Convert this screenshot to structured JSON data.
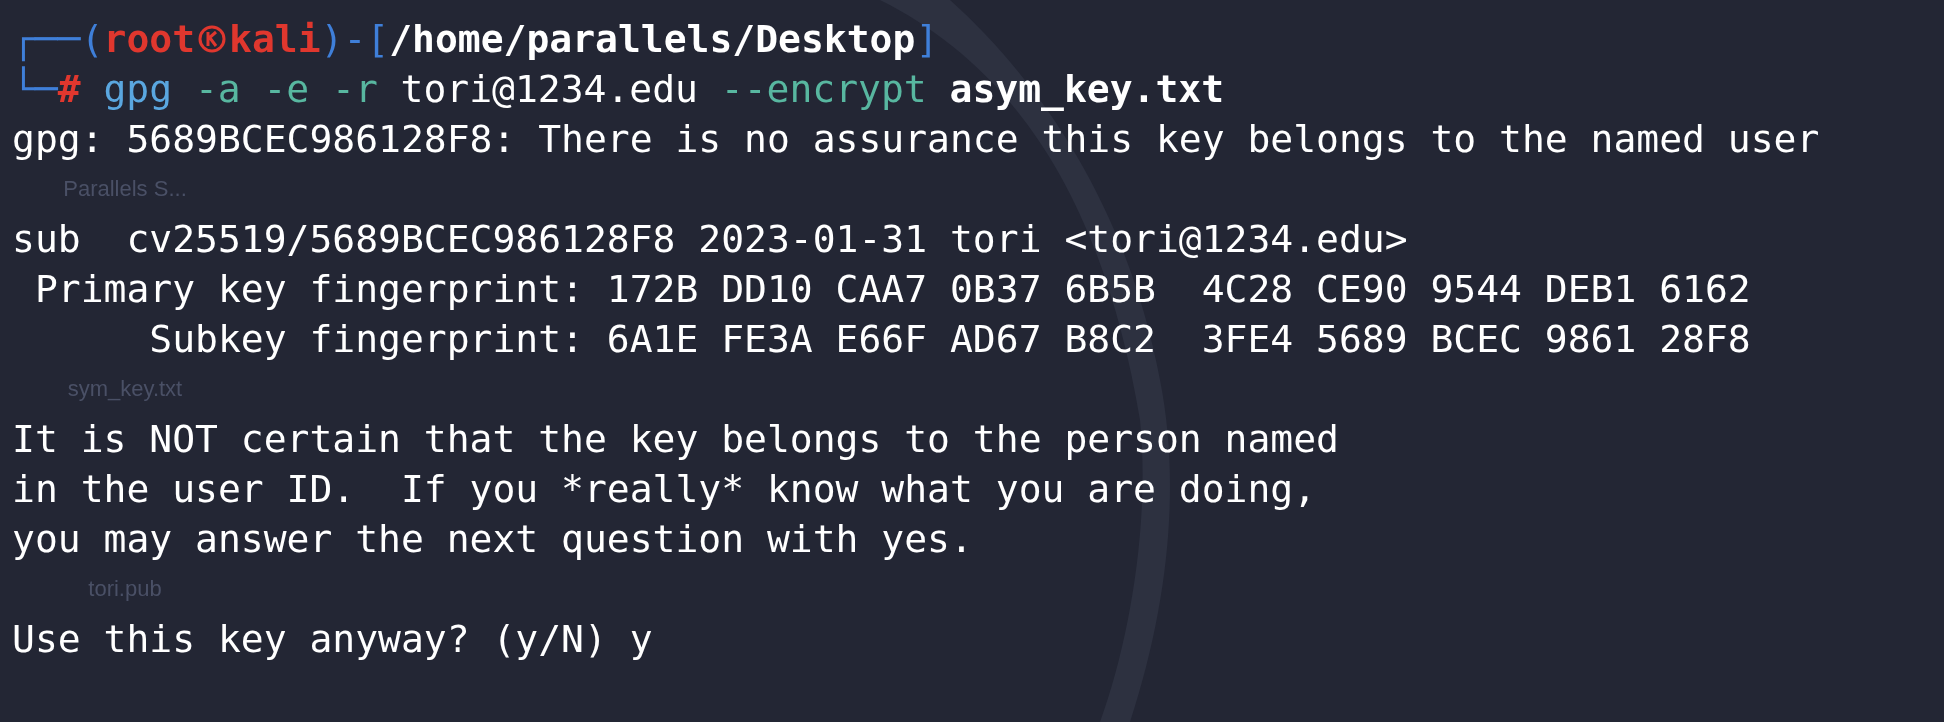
{
  "desktop_icons": [
    {
      "label": "Parallels S..."
    },
    {
      "label": "sym_key.txt"
    },
    {
      "label": "tori.pub"
    }
  ],
  "prompt": {
    "corner_top": "┌──(",
    "separator": ")-[",
    "close": "]",
    "corner_bottom": "└─",
    "user": "root",
    "host": "kali",
    "path": "/home/parallels/Desktop",
    "symbol": "#",
    "command": [
      {
        "kind": "program",
        "text": "gpg"
      },
      {
        "kind": "option",
        "text": "-a"
      },
      {
        "kind": "option",
        "text": "-e"
      },
      {
        "kind": "option",
        "text": "-r"
      },
      {
        "kind": "argument",
        "text": "tori@1234.edu"
      },
      {
        "kind": "option",
        "text": "--encrypt"
      },
      {
        "kind": "file",
        "text": "asym_key.txt"
      }
    ]
  },
  "output": [
    [
      "gpg: 5689BCEC986128F8: There is no assurance this key belongs to the named user"
    ],
    [
      "sub  cv25519/5689BCEC986128F8 2023-01-31 tori <tori@1234.edu>",
      " Primary key fingerprint: 172B DD10 CAA7 0B37 6B5B  4C28 CE90 9544 DEB1 6162",
      "      Subkey fingerprint: 6A1E FE3A E66F AD67 B8C2  3FE4 5689 BCEC 9861 28F8"
    ],
    [
      "It is NOT certain that the key belongs to the person named",
      "in the user ID.  If you *really* know what you are doing,",
      "you may answer the next question with yes."
    ],
    [
      "Use this key anyway? (y/N) y"
    ]
  ]
}
